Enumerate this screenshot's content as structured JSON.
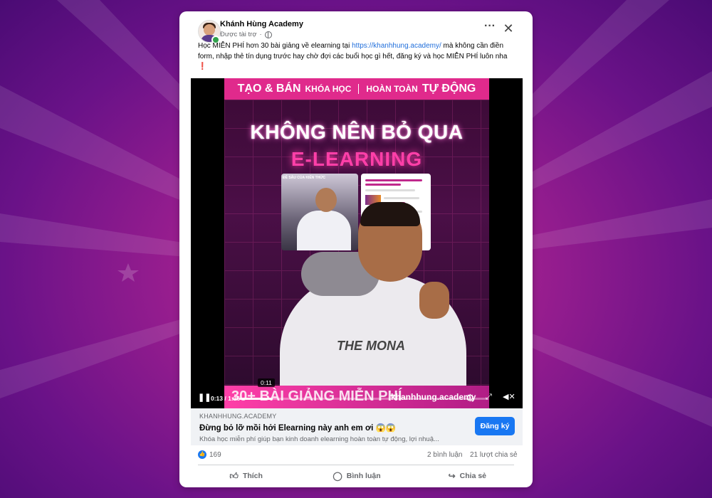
{
  "post": {
    "page_name": "Khánh Hùng Academy",
    "sponsored_label": "Được tài trợ",
    "caption_before": "Học MIỄN PHÍ hơn 30 bài giảng về elearning tại ",
    "caption_link": "https://khanhhung.academy/",
    "caption_after": " mà không cần điền form, nhập thẻ tín dụng trước hay chờ đợi các buổi học gì hết, đăng ký và học MIỄN PHÍ luôn nha",
    "caption_emoji": "❗"
  },
  "video": {
    "banner_1": "TẠO & BÁN",
    "banner_2": "KHÓA HỌC",
    "banner_3": "HOÀN TOÀN",
    "banner_4": "TỰ ĐỘNG",
    "headline_1": "KHÔNG NÊN BỎ QUA",
    "headline_2": "E-LEARNING",
    "inset_label": "ĐỀ SÂU CỦA KIẾN THỨC",
    "shirt_logo": "THE MONA",
    "bottom_text": "30+ BÀI GIẢNG MIỄN PHÍ",
    "bottom_url": "khanhhung.academy",
    "hover_time": "0:11",
    "time": "0:13 / 1:36",
    "progress": 0.135
  },
  "link": {
    "domain": "KHANHHUNG.ACADEMY",
    "title": "Đừng bỏ lỡ mồi hởi Elearning này anh em ơi 😱😱",
    "description": "Khóa học miễn phí giúp bạn kinh doanh elearning hoàn toàn tự động, lợi nhuậ...",
    "button": "Đăng ký"
  },
  "stats": {
    "likes": "169",
    "comments": "2 bình luận",
    "shares": "21 lượt chia sẻ"
  },
  "actions": {
    "like": "Thích",
    "comment": "Bình luận",
    "share": "Chia sẻ"
  },
  "colors": {
    "accent": "#1877f2",
    "video_pink": "#e02a8c"
  }
}
